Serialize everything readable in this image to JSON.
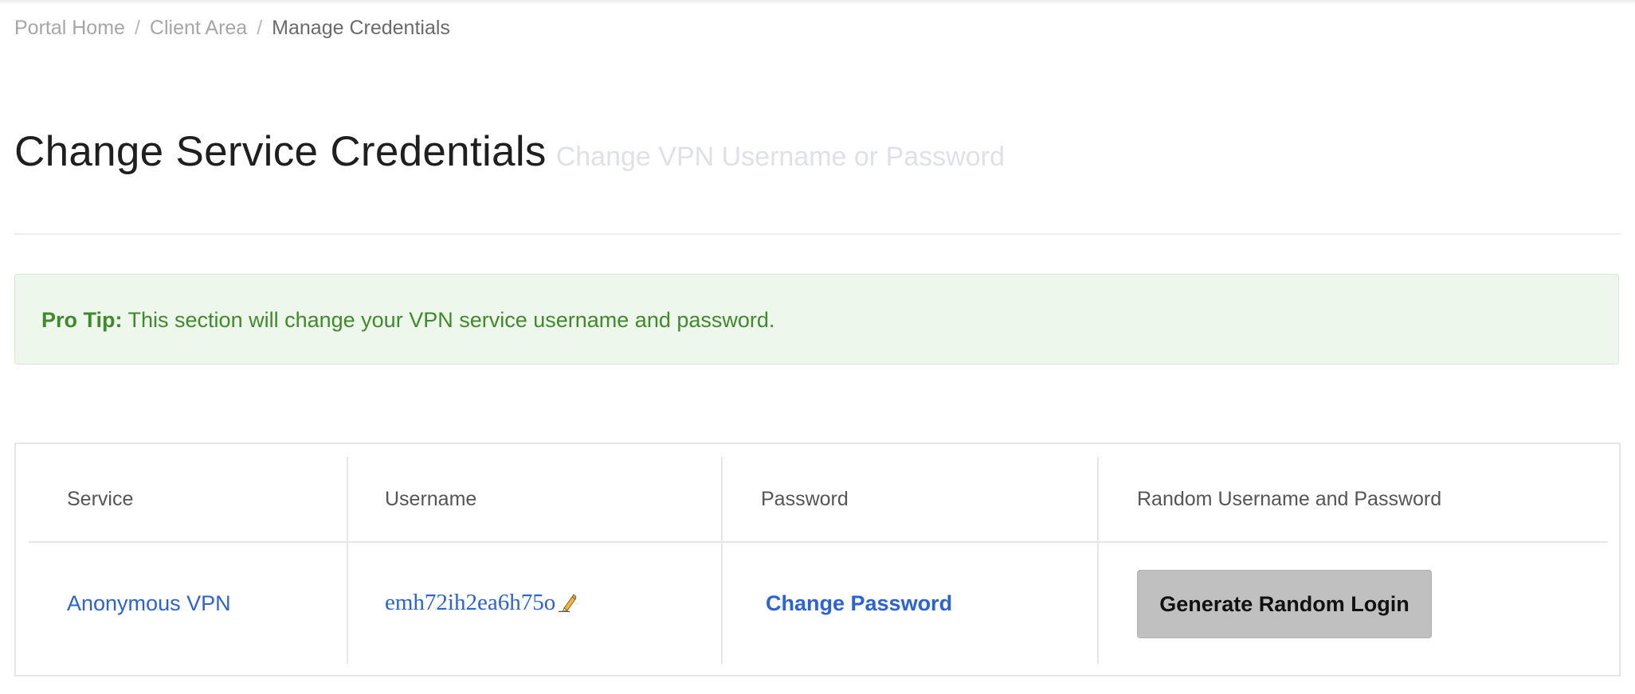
{
  "breadcrumb": {
    "items": [
      {
        "label": "Portal Home"
      },
      {
        "label": "Client Area"
      }
    ],
    "current": "Manage Credentials",
    "separator": "/"
  },
  "page": {
    "title": "Change Service Credentials",
    "subtitle": "Change VPN Username or Password"
  },
  "alert": {
    "label": "Pro Tip:",
    "text": "This section will change your VPN service username and password."
  },
  "table": {
    "headers": {
      "service": "Service",
      "username": "Username",
      "password": "Password",
      "random": "Random Username and Password"
    },
    "rows": [
      {
        "service": "Anonymous VPN",
        "username": "emh72ih2ea6h75o",
        "password_action": "Change Password",
        "random_action": "Generate Random Login"
      }
    ]
  },
  "colors": {
    "link": "#2a62d9",
    "alert_bg": "#eef7ec",
    "alert_text": "#3f8a2a",
    "button_bg": "#c0c0c0"
  },
  "icons": {
    "edit_username": "pencil-icon"
  }
}
